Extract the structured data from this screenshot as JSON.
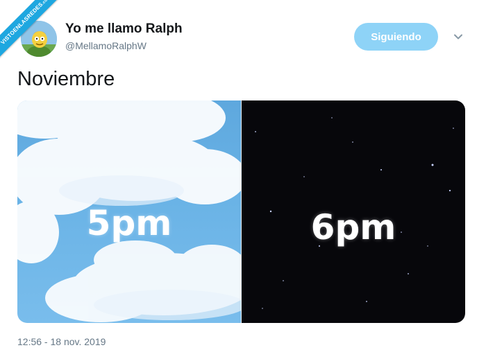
{
  "watermark": {
    "text": "VISTOENLASREDES",
    "suffix": ".com"
  },
  "author": {
    "name": "Yo me llamo Ralph",
    "handle": "@MellamoRalphW",
    "avatar_icon": "ralph-avatar-icon"
  },
  "actions": {
    "follow_label": "Siguiendo",
    "follow_color": "#8ed3f7",
    "menu_icon": "chevron-down-icon"
  },
  "tweet": {
    "text": "Noviembre",
    "media": [
      {
        "label": "5pm",
        "scene": "blue-sky-clouds"
      },
      {
        "label": "6pm",
        "scene": "night-sky-stars"
      }
    ],
    "timestamp": "12:56 - 18 nov. 2019"
  },
  "colors": {
    "text_primary": "#14171a",
    "text_secondary": "#657786",
    "sky": "#6ab3e6",
    "night": "#07070b"
  }
}
